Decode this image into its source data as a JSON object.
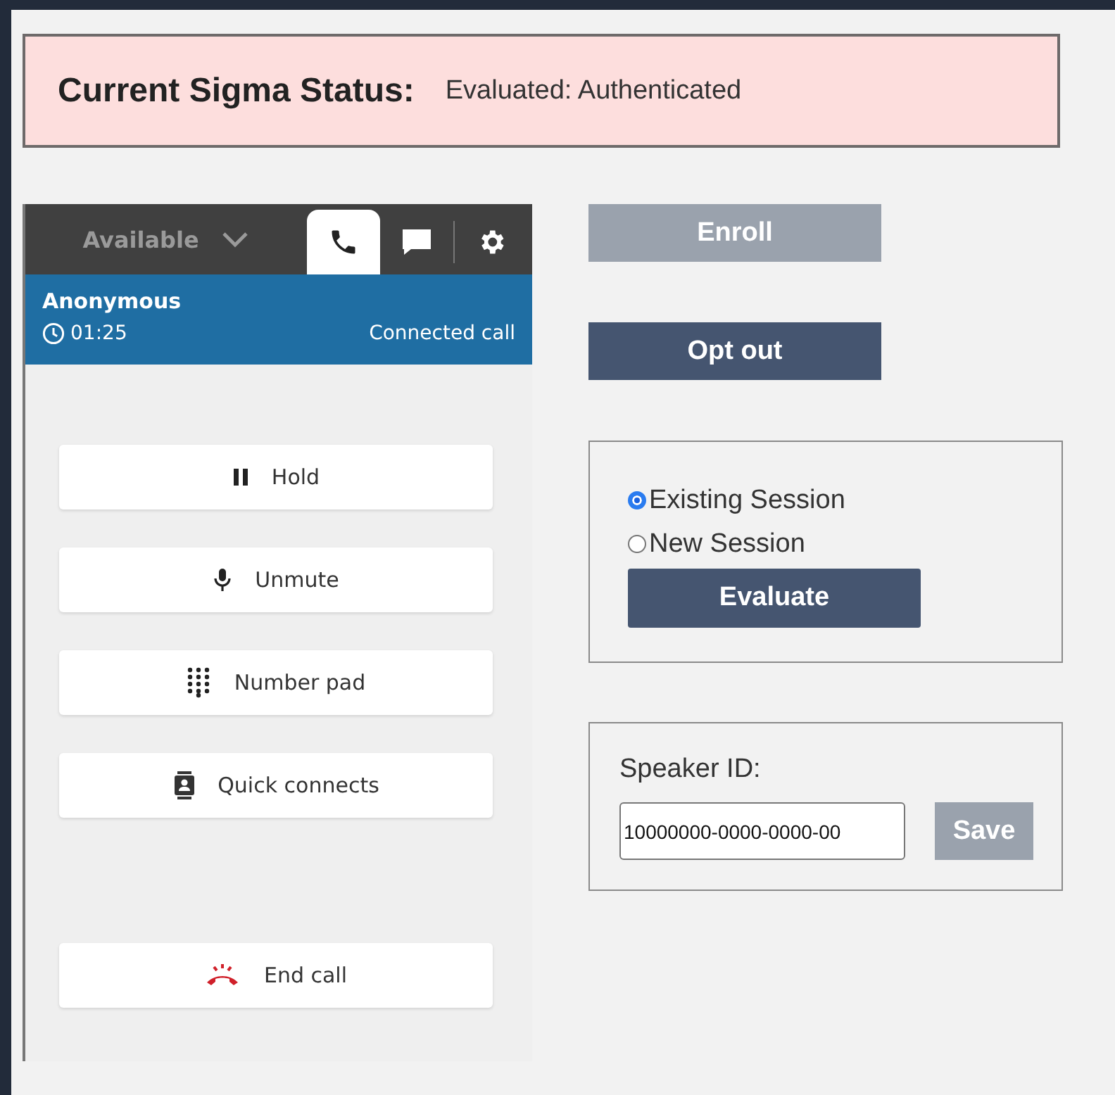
{
  "status": {
    "label": "Current Sigma Status:",
    "value": "Evaluated: Authenticated"
  },
  "ccp": {
    "agent_status": "Available",
    "tabs": [
      {
        "kind": "phone",
        "selected": true
      },
      {
        "kind": "chat",
        "selected": false
      },
      {
        "kind": "settings",
        "selected": false
      }
    ],
    "contact": {
      "name": "Anonymous",
      "timer": "01:25",
      "state": "Connected call"
    },
    "actions": [
      {
        "kind": "hold",
        "label": "Hold"
      },
      {
        "kind": "mic",
        "label": "Unmute"
      },
      {
        "kind": "numpad",
        "label": "Number pad"
      },
      {
        "kind": "contacts",
        "label": "Quick connects"
      },
      {
        "kind": "end",
        "label": "End call"
      }
    ]
  },
  "enroll": {
    "label": "Enroll",
    "disabled": true
  },
  "opt_out": {
    "label": "Opt out",
    "disabled": false
  },
  "session": {
    "options": [
      {
        "label": "Existing Session",
        "selected": true
      },
      {
        "label": "New Session",
        "selected": false
      }
    ],
    "button": "Evaluate"
  },
  "speaker": {
    "label": "Speaker ID:",
    "value": "10000000-0000-0000-00",
    "save": {
      "label": "Save",
      "disabled": true
    }
  }
}
